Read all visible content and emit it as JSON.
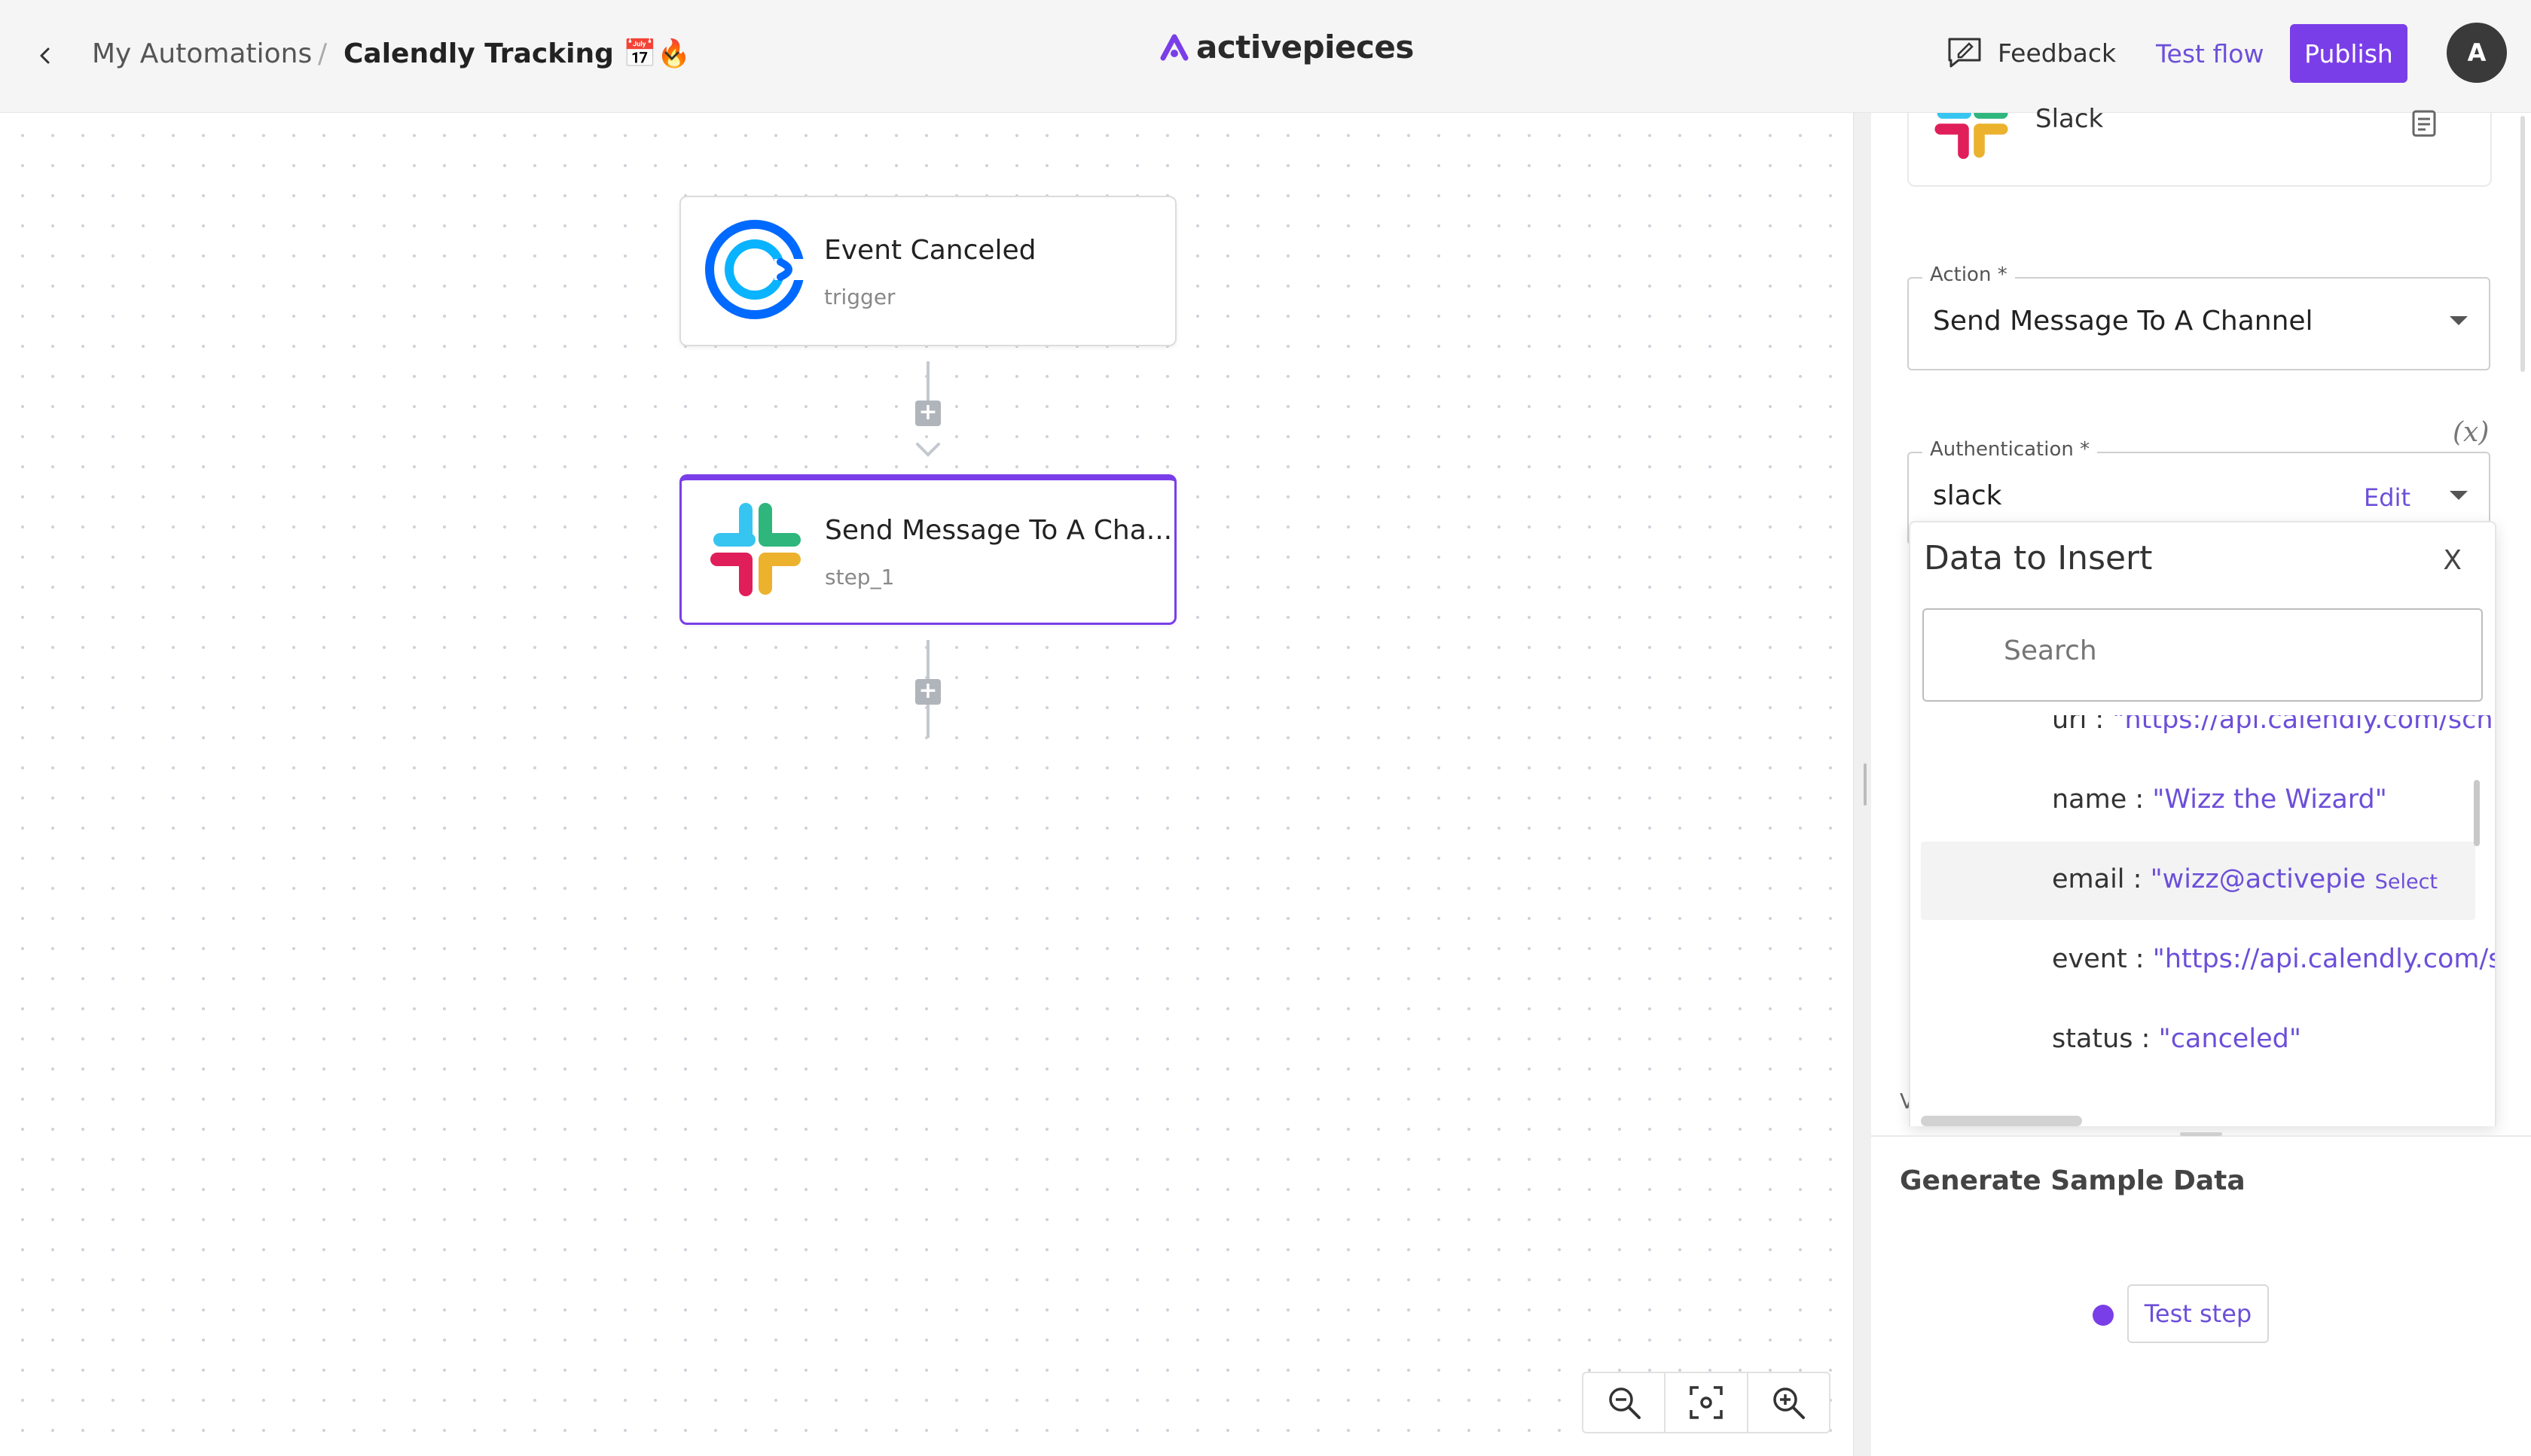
{
  "header": {
    "breadcrumb_root": "My Automations",
    "breadcrumb_separator": "/",
    "flow_name": "Calendly Tracking 📅🔥",
    "logo_text": "activepieces",
    "feedback_label": "Feedback",
    "test_flow_label": "Test flow",
    "publish_label": "Publish",
    "avatar_initial": "A"
  },
  "canvas": {
    "trigger_node": {
      "title": "Event Canceled",
      "subtitle": "trigger",
      "icon": "calendly-icon"
    },
    "action_node": {
      "title": "Send Message To A Cha...",
      "subtitle": "step_1",
      "icon": "slack-icon"
    },
    "add_step_symbol": "+",
    "zoom_controls": [
      "zoom-out-icon",
      "fit-view-icon",
      "zoom-in-icon"
    ]
  },
  "panel": {
    "piece_name": "Slack",
    "action_field": {
      "label": "Action *",
      "value": "Send Message To A Channel"
    },
    "auth_field": {
      "label": "Authentication *",
      "value": "slack",
      "edit_label": "Edit"
    },
    "fx_symbol": "(x)",
    "peek_text": "V"
  },
  "data_to_insert": {
    "title": "Data to Insert",
    "close_symbol": "X",
    "search_placeholder": "Search",
    "select_label": "Select",
    "rows": [
      {
        "key": "uri : ",
        "value": "\"https://api.calendly.com/sch"
      },
      {
        "key": "name : ",
        "value": "\"Wizz the Wizard\""
      },
      {
        "key": "email : ",
        "value": "\"wizz@activepiec"
      },
      {
        "key": "event : ",
        "value": "\"https://api.calendly.com/s"
      },
      {
        "key": "status : ",
        "value": "\"canceled\""
      }
    ]
  },
  "sample_data": {
    "title": "Generate Sample Data",
    "test_step_label": "Test step"
  },
  "colors": {
    "accent": "#7a3ee8",
    "link": "#6c4fd9",
    "header_bg": "#f5f5f5"
  }
}
